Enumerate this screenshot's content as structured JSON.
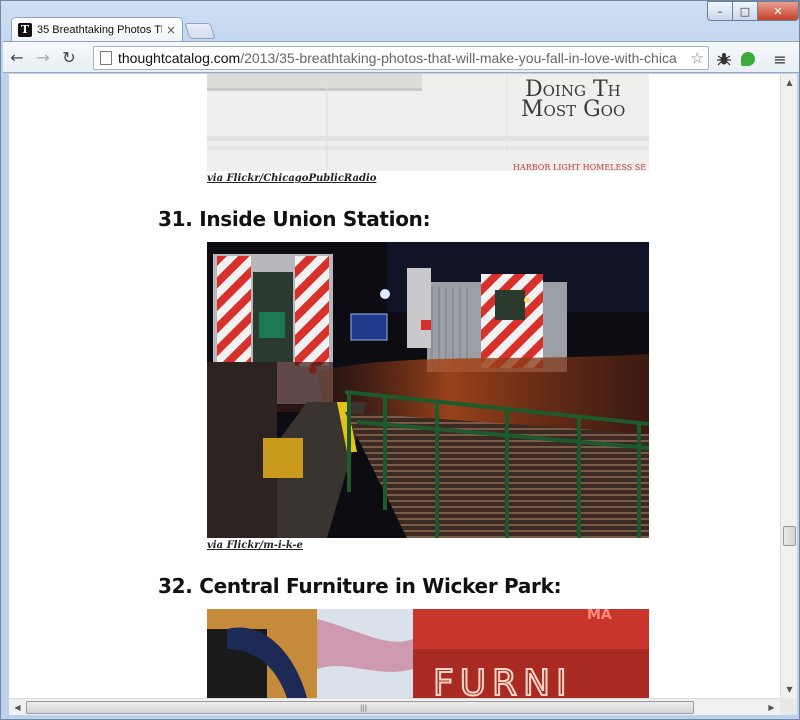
{
  "browser": {
    "tab": {
      "favicon_letter": "T",
      "title": "35 Breathtaking Photos Th",
      "close": "×"
    },
    "window_controls": {
      "minimize": "–",
      "maximize": "□",
      "close": "✕"
    },
    "nav": {
      "back": "←",
      "forward": "→",
      "reload": "↻"
    },
    "address": {
      "domain": "thoughtcatalog.com",
      "path": "/2013/35-breathtaking-photos-that-will-make-you-fall-in-love-with-chica"
    },
    "star": "☆",
    "extensions": [
      "bug-icon",
      "leaf-icon"
    ],
    "menu": "≡"
  },
  "article": {
    "photo_top": {
      "sign_line1": "Doing Th",
      "sign_line2": "Most Goo",
      "sign_footer": "HARBOR LIGHT HOMELESS SE",
      "caption": "via Flickr/ChicagoPublicRadio"
    },
    "section_31": {
      "heading": "31. Inside Union Station:",
      "caption": "via Flickr/m-i-k-e"
    },
    "section_32": {
      "heading": "32. Central Furniture in Wicker Park:",
      "sign_text": "FURNI"
    }
  },
  "scrollbars": {
    "up": "▲",
    "down": "▼",
    "left": "◀",
    "right": "▶",
    "grip": "|||"
  },
  "colors": {
    "caption_link": "#222222",
    "heading": "#111111",
    "sign_red": "#d2312a",
    "neon_orange": "#f08a3c"
  }
}
